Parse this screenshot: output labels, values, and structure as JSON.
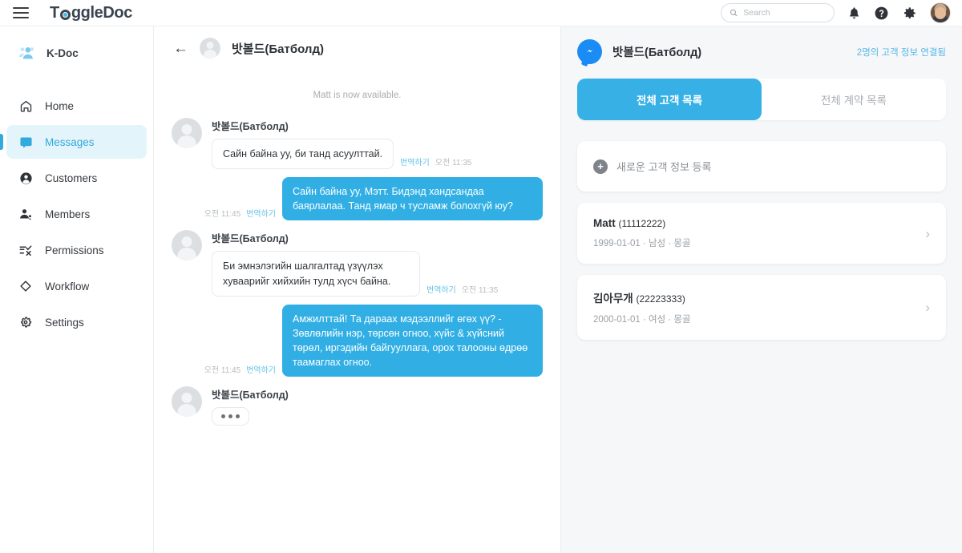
{
  "topbar": {
    "menu_icon": "hamburger-icon",
    "logo_text_before": "T",
    "logo_text_after": "ggleDoc",
    "search_placeholder": "Search",
    "search_value": "",
    "icons": [
      "search-icon",
      "bell-icon",
      "help-icon",
      "gear-icon",
      "avatar"
    ]
  },
  "sidebar": {
    "org_name": "K-Doc",
    "items": [
      {
        "label": "Home",
        "icon": "home-icon",
        "active": false
      },
      {
        "label": "Messages",
        "icon": "message-icon",
        "active": true
      },
      {
        "label": "Customers",
        "icon": "person-icon",
        "active": false
      },
      {
        "label": "Members",
        "icon": "members-icon",
        "active": false
      },
      {
        "label": "Permissions",
        "icon": "checklist-icon",
        "active": false
      },
      {
        "label": "Workflow",
        "icon": "diamond-icon",
        "active": false
      },
      {
        "label": "Settings",
        "icon": "gear-icon",
        "active": false
      }
    ]
  },
  "chat": {
    "back_icon": "back-arrow-icon",
    "title": "밧볼드(Батболд)",
    "system_note": "Matt is now available.",
    "messages": [
      {
        "direction": "in",
        "sender": "밧볼드(Батболд)",
        "text": "Сайн байна уу, би танд асуулттай.",
        "translate": "번역하기",
        "time": "오전 11:35"
      },
      {
        "direction": "out",
        "sender": "",
        "text": "Сайн байна уу, Мэтт. Бидэнд хандсандаа баярлалаа. Танд ямар ч тусламж болохгүй юу?",
        "translate": "번역하기",
        "time": "오전 11:45"
      },
      {
        "direction": "in",
        "sender": "밧볼드(Батболд)",
        "text": "Би эмнэлэгийн шалгалтад үзүүлэх хуваарийг хийхийн тулд хүсч байна.",
        "translate": "번역하기",
        "time": "오전 11:35"
      },
      {
        "direction": "out",
        "sender": "",
        "text": "Амжилттай! Та дараах мэдээллийг өгөх үү? - Зөвлөлийн нэр, төрсөн огноо, хүйс & хүйсний төрөл, иргэдийн байгууллага, орох талооны өдрөө таамаглах огноо.",
        "translate": "번역하기",
        "time": "오전 11:45"
      }
    ],
    "typing": {
      "sender": "밧볼드(Батболд)",
      "dots": "•••"
    }
  },
  "panel": {
    "channel_icon": "messenger-icon",
    "name": "밧볼드(Батболд)",
    "link": "2명의 고객 정보 연결됨",
    "tabs": [
      {
        "label": "전체 고객 목록",
        "active": true
      },
      {
        "label": "전체 계약 목록",
        "active": false
      }
    ],
    "add_label": "새로운 고객 정보 등록",
    "customers": [
      {
        "name": "Matt",
        "id": "(11112222)",
        "sub": "1999-01-01 · 남성 · 몽골"
      },
      {
        "name": "김아무개",
        "id": "(22223333)",
        "sub": "2000-01-01 · 여성 · 몽골"
      }
    ]
  },
  "colors": {
    "accent": "#33a9dd",
    "bubble_out": "#31afe4",
    "tab_active": "#36b0e5",
    "panel_bg": "#f5f7f8",
    "messenger_blue": "#1b8cf5"
  }
}
